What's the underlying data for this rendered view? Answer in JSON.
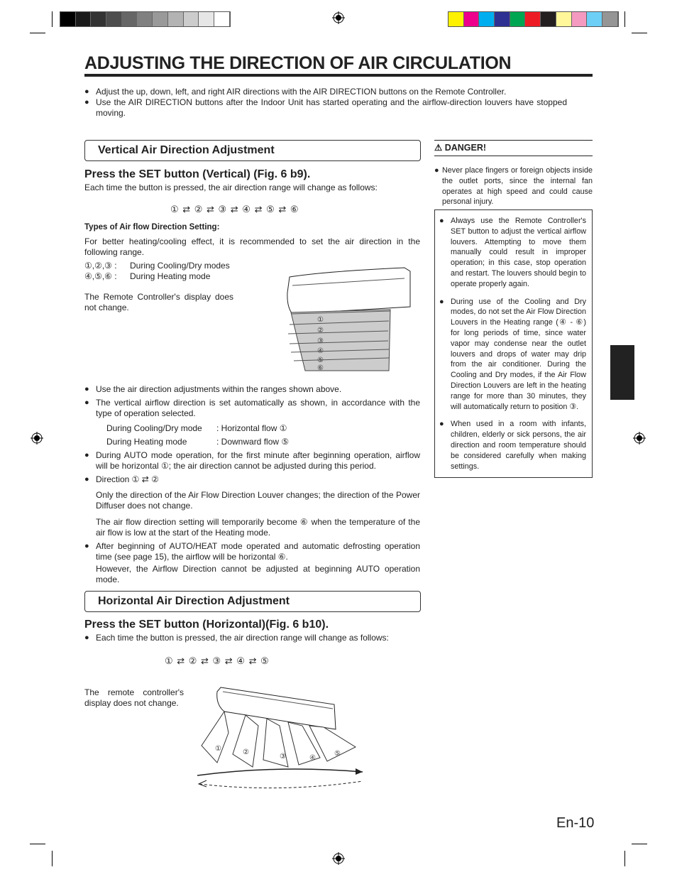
{
  "colors": {
    "gray_bars": [
      "#000000",
      "#1a1a1a",
      "#333333",
      "#4d4d4d",
      "#666666",
      "#808080",
      "#999999",
      "#b3b3b3",
      "#cccccc",
      "#e6e6e6",
      "#ffffff"
    ],
    "color_bars": [
      "#fff200",
      "#ec008c",
      "#00aeef",
      "#2e3192",
      "#00a651",
      "#ed1c24",
      "#231f20",
      "#fff799",
      "#f49ac1",
      "#6dcff6",
      "#959595"
    ]
  },
  "title": "ADJUSTING THE DIRECTION OF AIR CIRCULATION",
  "intro": [
    "Adjust the up, down, left, and right AIR directions with the AIR DIRECTION buttons on the Remote Controller.",
    "Use the AIR DIRECTION buttons after the Indoor Unit has started operating and the airflow-direction louvers have stopped moving."
  ],
  "vertical": {
    "section_title": "Vertical Air Direction Adjustment",
    "heading": "Press the SET button (Vertical) (Fig. 6 b9).",
    "desc": "Each time the button is pressed, the air direction range will change as follows:",
    "sequence": "① ⇄ ② ⇄ ③ ⇄ ④ ⇄ ⑤ ⇄ ⑥",
    "types_heading": "Types of Air flow Direction Setting:",
    "types_desc": "For better heating/cooling effect, it is recommended to set the air direction in the following range.",
    "modes": [
      {
        "positions": "①,②,③ :",
        "mode": "During Cooling/Dry modes"
      },
      {
        "positions": "④,⑤,⑥ :",
        "mode": "During Heating mode"
      }
    ],
    "display_note": "The Remote Controller's display does not change.",
    "figure_labels": [
      "①",
      "②",
      "③",
      "④",
      "⑤",
      "⑥"
    ],
    "bullets": [
      "Use the air direction adjustments within the ranges shown above.",
      "The vertical airflow direction is set automatically as shown, in accordance with the type of operation selected."
    ],
    "auto_table": [
      {
        "mode": "During Cooling/Dry mode",
        "flow": ":   Horizontal flow ①"
      },
      {
        "mode": "During Heating mode",
        "flow": ":   Downward flow ⑤"
      }
    ],
    "auto_bullet": "During AUTO mode operation, for the first minute after beginning operation, airflow will be horizontal ①; the air direction cannot be adjusted during this period.",
    "direction_bullet": "Direction ① ⇄ ②",
    "direction_p1": "Only the direction of the Air Flow Direction Louver changes; the direction of the Power Diffuser does not change.",
    "direction_p2": "The air flow direction setting will temporarily become ⑥ when the temperature of the air flow is low at the start of the Heating mode.",
    "defrost_bullet": "After beginning of AUTO/HEAT mode operated and automatic defrosting operation time (see page 15), the airflow will be horizontal ⑥.",
    "defrost_p": "However, the Airflow Direction cannot be adjusted at beginning AUTO operation mode."
  },
  "horizontal": {
    "section_title": "Horizontal Air Direction Adjustment",
    "heading": "Press the SET button (Horizontal)(Fig. 6 b10).",
    "desc": "Each time the button is pressed, the air direction range will change as follows:",
    "sequence": "① ⇄ ② ⇄ ③ ⇄ ④ ⇄ ⑤",
    "display_note": "The remote controller's display does not change.",
    "figure_labels": [
      "①",
      "②",
      "③",
      "④",
      "⑤"
    ]
  },
  "danger": {
    "title": "DANGER!",
    "icon": "warning-triangle-icon",
    "text": "Never place fingers or foreign objects inside the outlet ports, since the internal fan operates at high speed and could cause personal injury."
  },
  "notes": [
    "Always use the Remote Controller's SET button to adjust the vertical airflow louvers. Attempting to move them manually could result in improper operation; in this case, stop operation and restart. The louvers should begin to operate properly again.",
    "During use of the Cooling and Dry modes, do not set the Air Flow Direction Louvers in the Heating range (④ - ⑥) for long periods of time, since water vapor may condense near the outlet louvers and drops of water may drip from the air conditioner. During the Cooling and Dry modes, if the Air Flow Direction Louvers are left in the heating range for more than 30 minutes, they will automatically return to position ③.",
    "When used in a room with infants, children, elderly or sick persons, the air direction and room temperature should be considered carefully when making settings."
  ],
  "page_number": "En-10"
}
